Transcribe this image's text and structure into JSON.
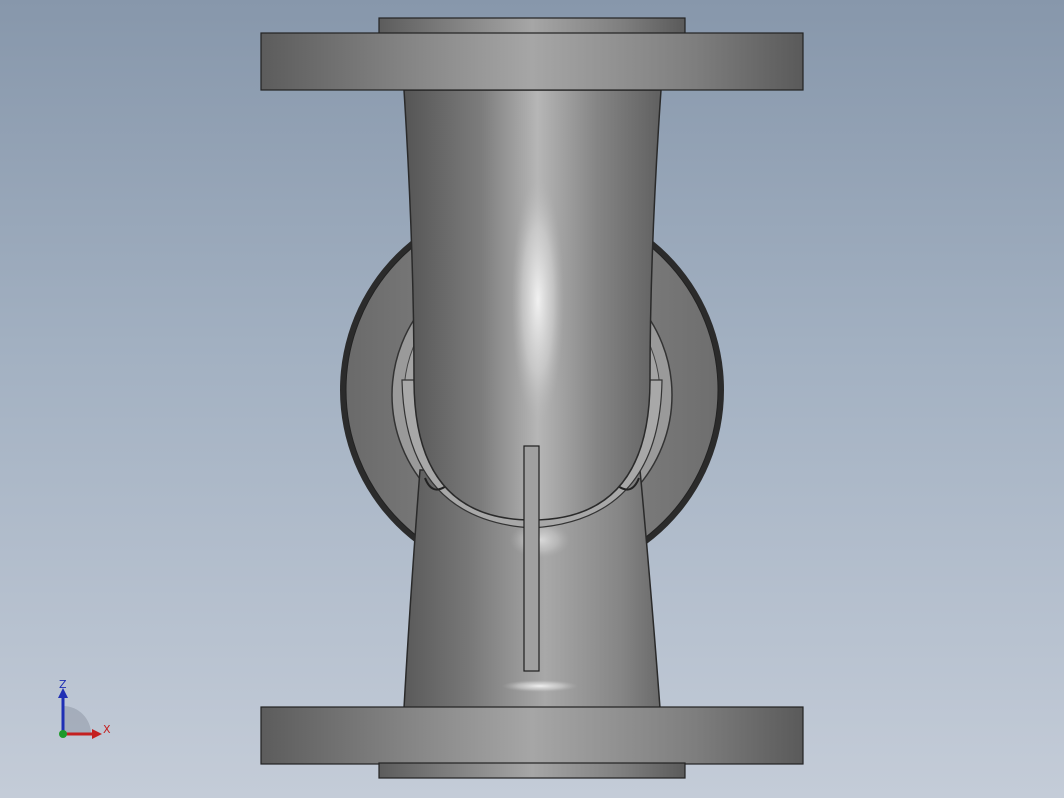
{
  "viewport": {
    "background_top": "#8797ab",
    "background_bottom": "#c4ccd8"
  },
  "model": {
    "body_color": "#8e8e8e",
    "edge_color": "#1a1a1a",
    "highlight_color": "#f2f2f2"
  },
  "triad": {
    "z_label": "Z",
    "x_label": "X",
    "z_color": "#1f2fb4",
    "x_color": "#c42020",
    "origin_color": "#1e9a2a"
  }
}
